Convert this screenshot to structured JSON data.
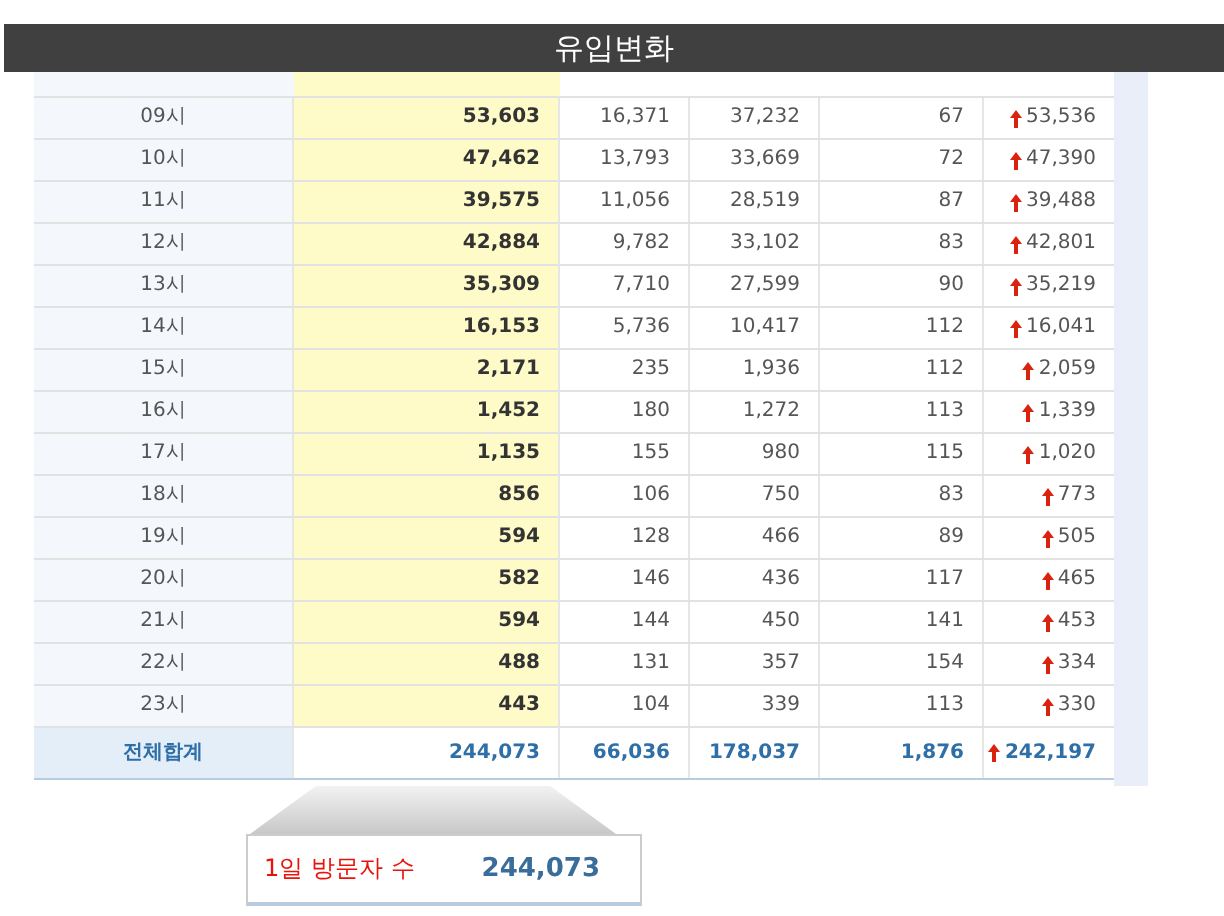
{
  "title": "유입변화",
  "rows": [
    {
      "hour": "09시",
      "cells": [
        "53,603",
        "16,371",
        "37,232",
        "67"
      ],
      "change": "53,536",
      "rising": true
    },
    {
      "hour": "10시",
      "cells": [
        "47,462",
        "13,793",
        "33,669",
        "72"
      ],
      "change": "47,390",
      "rising": true
    },
    {
      "hour": "11시",
      "cells": [
        "39,575",
        "11,056",
        "28,519",
        "87"
      ],
      "change": "39,488",
      "rising": true
    },
    {
      "hour": "12시",
      "cells": [
        "42,884",
        "9,782",
        "33,102",
        "83"
      ],
      "change": "42,801",
      "rising": true
    },
    {
      "hour": "13시",
      "cells": [
        "35,309",
        "7,710",
        "27,599",
        "90"
      ],
      "change": "35,219",
      "rising": true
    },
    {
      "hour": "14시",
      "cells": [
        "16,153",
        "5,736",
        "10,417",
        "112"
      ],
      "change": "16,041",
      "rising": true
    },
    {
      "hour": "15시",
      "cells": [
        "2,171",
        "235",
        "1,936",
        "112"
      ],
      "change": "2,059",
      "rising": true
    },
    {
      "hour": "16시",
      "cells": [
        "1,452",
        "180",
        "1,272",
        "113"
      ],
      "change": "1,339",
      "rising": true
    },
    {
      "hour": "17시",
      "cells": [
        "1,135",
        "155",
        "980",
        "115"
      ],
      "change": "1,020",
      "rising": true
    },
    {
      "hour": "18시",
      "cells": [
        "856",
        "106",
        "750",
        "83"
      ],
      "change": "773",
      "rising": true
    },
    {
      "hour": "19시",
      "cells": [
        "594",
        "128",
        "466",
        "89"
      ],
      "change": "505",
      "rising": true
    },
    {
      "hour": "20시",
      "cells": [
        "582",
        "146",
        "436",
        "117"
      ],
      "change": "465",
      "rising": true
    },
    {
      "hour": "21시",
      "cells": [
        "594",
        "144",
        "450",
        "141"
      ],
      "change": "453",
      "rising": true
    },
    {
      "hour": "22시",
      "cells": [
        "488",
        "131",
        "357",
        "154"
      ],
      "change": "334",
      "rising": true
    },
    {
      "hour": "23시",
      "cells": [
        "443",
        "104",
        "339",
        "113"
      ],
      "change": "330",
      "rising": true
    }
  ],
  "total": {
    "label": "전체합계",
    "cells": [
      "244,073",
      "66,036",
      "178,037",
      "1,876"
    ],
    "change": "242,197",
    "rising": true
  },
  "callout": {
    "label": "1일 방문자 수",
    "value": "244,073"
  }
}
